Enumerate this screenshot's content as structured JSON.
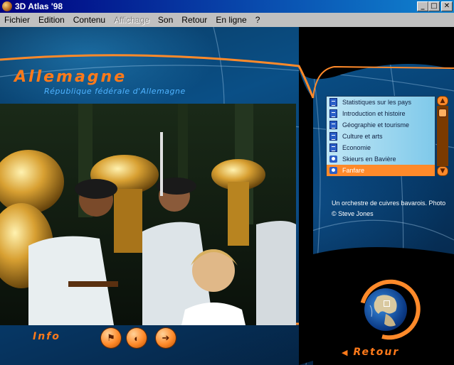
{
  "window": {
    "title": "3D Atlas '98",
    "minimize": "_",
    "maximize": "□",
    "close": "✕"
  },
  "menu": [
    {
      "label": "Fichier",
      "disabled": false
    },
    {
      "label": "Edition",
      "disabled": false
    },
    {
      "label": "Contenu",
      "disabled": false
    },
    {
      "label": "Affichage",
      "disabled": true
    },
    {
      "label": "Son",
      "disabled": false
    },
    {
      "label": "Retour",
      "disabled": false
    },
    {
      "label": "En ligne",
      "disabled": false
    },
    {
      "label": "?",
      "disabled": false
    }
  ],
  "country": {
    "name": "Allemagne",
    "subtitle": "République fédérale d'Allemagne"
  },
  "topics": [
    {
      "label": "Statistiques sur les pays",
      "icon": "document-icon",
      "selected": false
    },
    {
      "label": "Introduction et histoire",
      "icon": "document-icon",
      "selected": false
    },
    {
      "label": "Géographie et tourisme",
      "icon": "document-icon",
      "selected": false
    },
    {
      "label": "Culture et arts",
      "icon": "document-icon",
      "selected": false
    },
    {
      "label": "Economie",
      "icon": "document-icon",
      "selected": false
    },
    {
      "label": "Skieurs en Bavière",
      "icon": "camera-icon",
      "selected": false
    },
    {
      "label": "Fanfare",
      "icon": "camera-icon",
      "selected": true
    }
  ],
  "scroll": {
    "up": "▲",
    "down": "▼"
  },
  "caption": {
    "line1": "Un orchestre de cuivres bavarois. Photo",
    "line2": "© Steve Jones"
  },
  "bottom": {
    "info_label": "Info",
    "buttons": [
      {
        "glyph": "⚑",
        "icon": "flag-icon"
      },
      {
        "glyph": "◐",
        "icon": "camera-rotate-icon"
      },
      {
        "glyph": "➔",
        "icon": "forward-arrow-icon"
      }
    ],
    "retour_label": "Retour",
    "retour_arrow": "◀"
  },
  "colors": {
    "accent": "#ff8a2a",
    "subtitle": "#4fb3ff",
    "list_bg": "#bfe6f5",
    "selected": "#ff8a2a"
  }
}
